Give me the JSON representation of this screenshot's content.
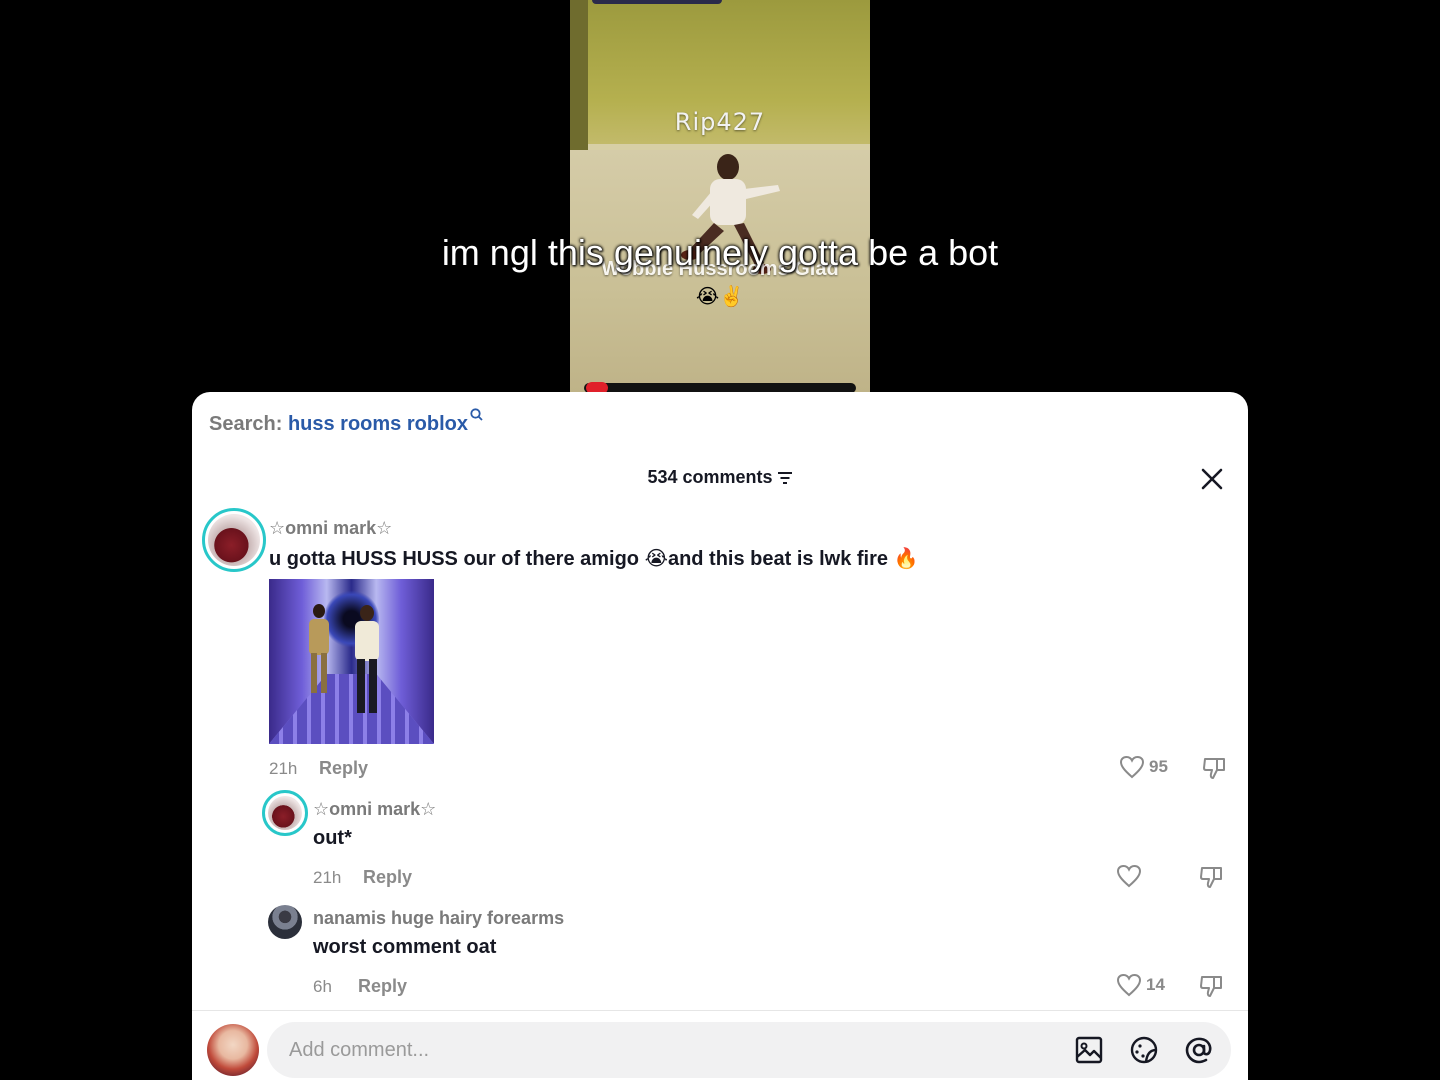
{
  "video": {
    "player_name": "Rip427",
    "overlay_text": "Wobble Hussrooms Glad",
    "overlay_emoji": "😭✌️",
    "caption": "im ngl this genuinely gotta be a bot"
  },
  "sheet": {
    "search_label": "Search:",
    "search_term": "huss rooms roblox",
    "comment_count": "534 comments"
  },
  "comments": [
    {
      "author": "☆omni mark☆",
      "text": "u gotta HUSS HUSS our of there amigo 😭and this beat is lwk fire 🔥",
      "time": "21h",
      "reply_label": "Reply",
      "likes": "95"
    },
    {
      "author": "☆omni mark☆",
      "text": "out*",
      "time": "21h",
      "reply_label": "Reply",
      "likes": ""
    },
    {
      "author": "nanamis huge hairy forearms",
      "text": "worst comment oat",
      "time": "6h",
      "reply_label": "Reply",
      "likes": "14"
    }
  ],
  "composer": {
    "placeholder": "Add comment..."
  },
  "icons": {
    "close": "close-icon",
    "sort": "sort-icon",
    "search": "search-icon",
    "like": "heart-icon",
    "dislike": "thumbs-down-icon",
    "image": "image-icon",
    "sticker": "sticker-icon",
    "mention": "at-mention-icon"
  },
  "colors": {
    "accent_ring": "#28c7c9",
    "search_term": "#2a5aa8",
    "progress": "#e0202a"
  }
}
